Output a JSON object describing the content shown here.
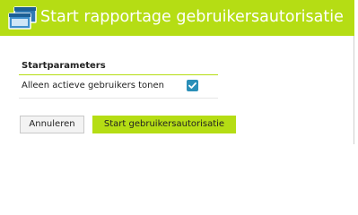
{
  "header": {
    "title": "Start rapportage gebruikersautorisatie",
    "icon": "windows-icon",
    "background": "#b5dd14"
  },
  "section": {
    "title": "Startparameters",
    "rows": [
      {
        "label": "Alleen actieve gebruikers tonen",
        "checked": true
      }
    ]
  },
  "actions": {
    "cancel_label": "Annuleren",
    "start_label": "Start gebruikersautorisatie"
  },
  "colors": {
    "accent": "#b5dd14",
    "checkbox": "#2b8fb8"
  }
}
